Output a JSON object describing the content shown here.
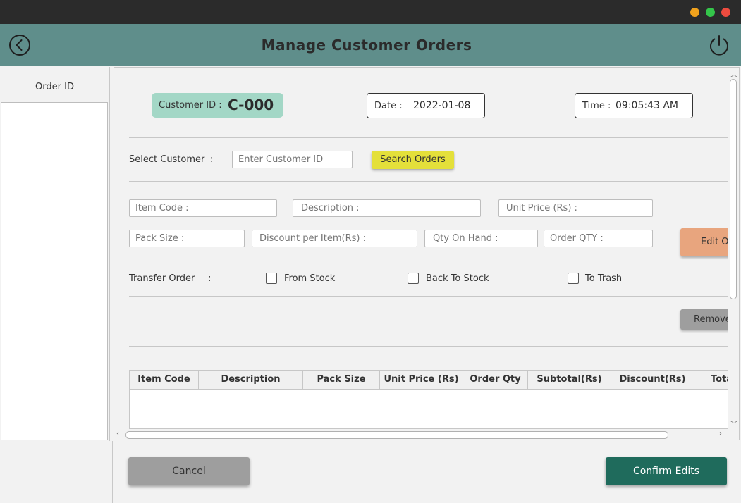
{
  "window": {
    "traffic_lights": [
      {
        "name": "minimize",
        "color": "#f0a21d"
      },
      {
        "name": "maximize",
        "color": "#34c54a"
      },
      {
        "name": "close",
        "color": "#ee4c3f"
      }
    ]
  },
  "header": {
    "title": "Manage Customer Orders",
    "back_icon": "chevron-left-circle-icon",
    "power_icon": "power-icon",
    "background": "#5f8e8b"
  },
  "sidebar": {
    "header": "Order ID",
    "items": []
  },
  "info": {
    "customer_label": "Customer ID :",
    "customer_value": "C-000",
    "date_label": "Date :",
    "date_value": "2022-01-08",
    "time_label": "Time :",
    "time_value": "09:05:43 AM"
  },
  "select_customer": {
    "label": "Select Customer",
    "colon": ":",
    "placeholder": "Enter Customer ID",
    "search_button": "Search Orders"
  },
  "fields": {
    "item_code": "Item Code :",
    "description": "Description :",
    "unit_price": "Unit Price (Rs) :",
    "pack_size": "Pack Size :",
    "discount": "Discount per Item(Rs) :",
    "qty_on_hand": "Qty On Hand :",
    "order_qty": "Order QTY :"
  },
  "transfer": {
    "label": "Transfer Order",
    "colon": ":",
    "options": [
      {
        "label": "From Stock",
        "checked": false
      },
      {
        "label": "Back To Stock",
        "checked": false
      },
      {
        "label": "To Trash",
        "checked": false
      }
    ]
  },
  "buttons": {
    "edit": "Edit Order",
    "remove": "Remove",
    "cancel": "Cancel",
    "confirm": "Confirm Edits"
  },
  "table": {
    "columns": [
      "Item Code",
      "Description",
      "Pack Size",
      "Unit Price (Rs)",
      "Order Qty",
      "Subtotal(Rs)",
      "Discount(Rs)",
      "Total"
    ],
    "rows": []
  }
}
